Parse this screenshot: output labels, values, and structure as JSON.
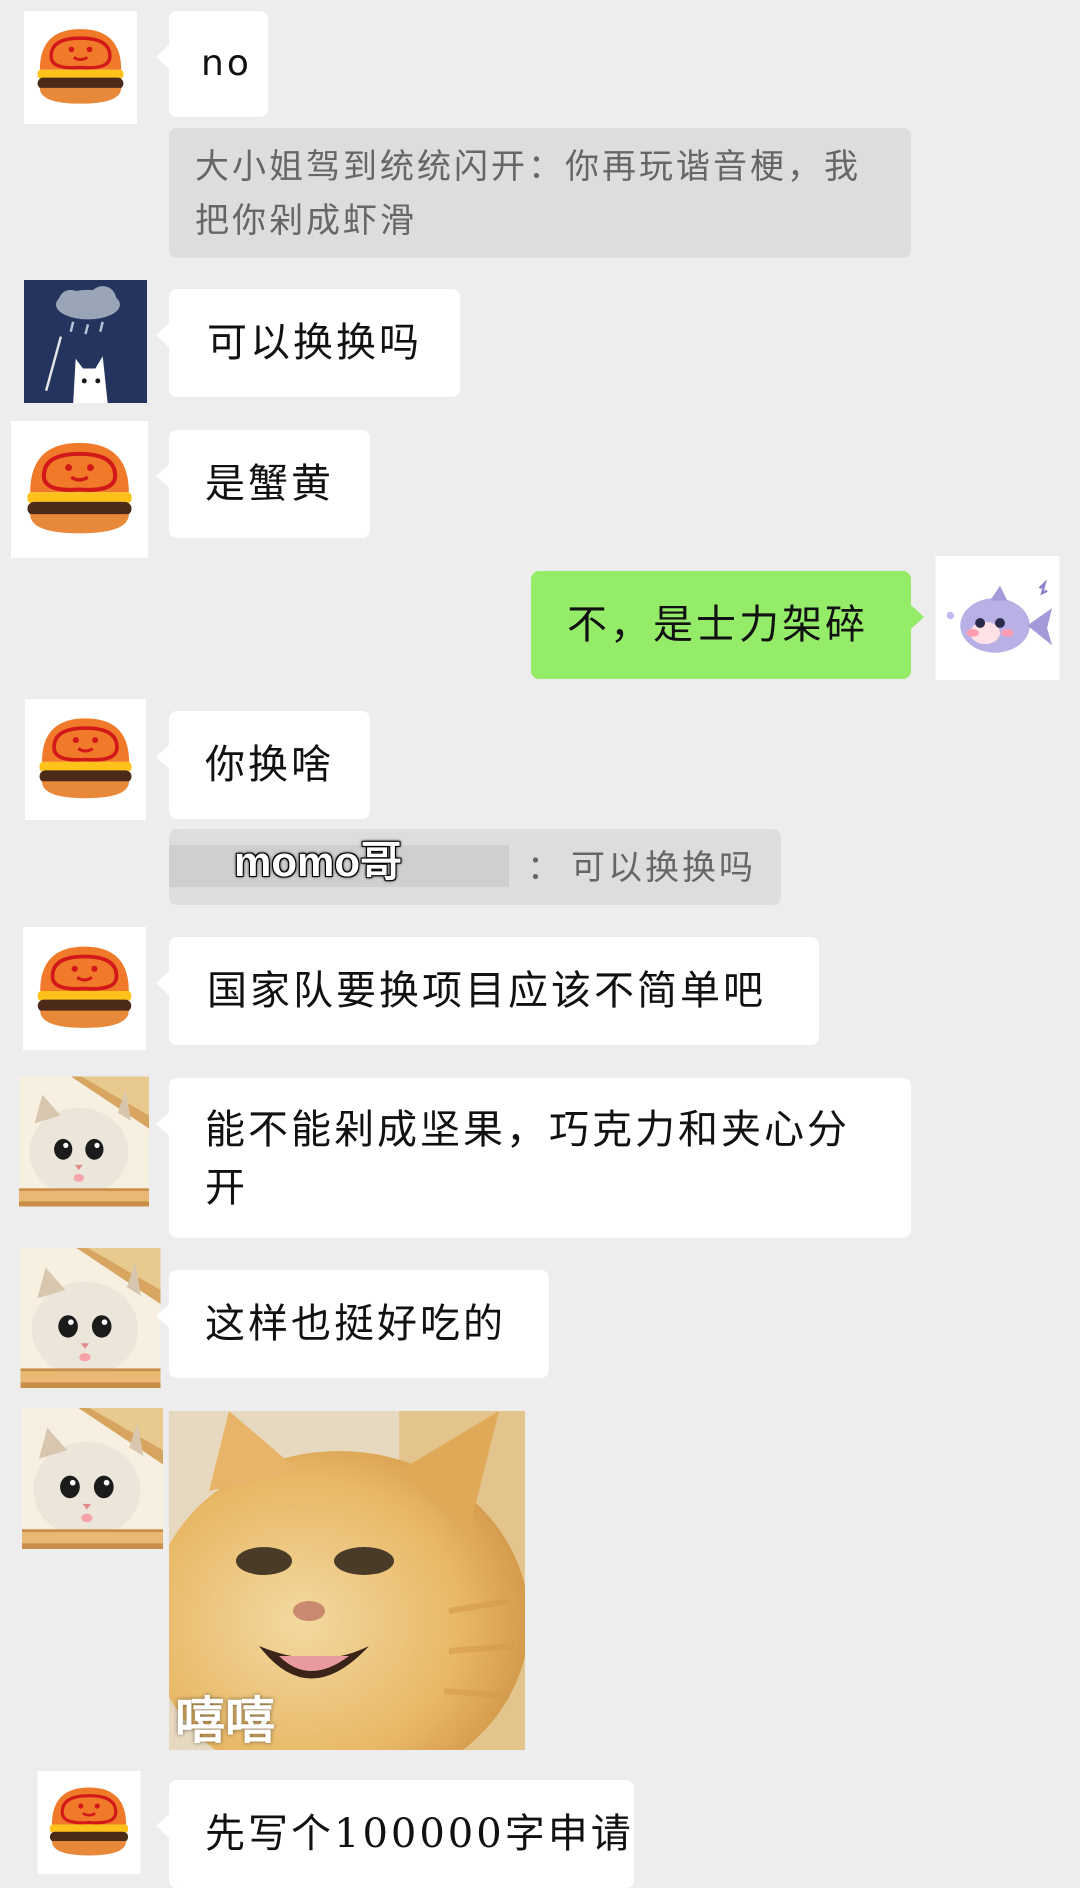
{
  "colors": {
    "background": "#ededed",
    "bubble_left": "#ffffff",
    "bubble_right": "#95ec69",
    "quote_bg": "#dddddd",
    "quote_text": "#666666"
  },
  "avatars": {
    "burger": "burger-avatar",
    "rain_cat": "rain-cloud-cat-avatar",
    "fish": "purple-fish-avatar",
    "bread_cat": "bread-cat-avatar"
  },
  "messages": [
    {
      "sender": "burger",
      "side": "left",
      "text": "no"
    },
    {
      "type": "quote",
      "text": "大小姐驾到统统闪开：你再玩谐音梗，我把你剁成虾滑"
    },
    {
      "sender": "rain_cat",
      "side": "left",
      "text": "可以换换吗"
    },
    {
      "sender": "burger",
      "side": "left",
      "text": "是蟹黄"
    },
    {
      "sender": "fish",
      "side": "right",
      "text": "不，是士力架碎"
    },
    {
      "sender": "burger",
      "side": "left",
      "text": "你换啥"
    },
    {
      "type": "quote",
      "name": "momo哥",
      "separator": "：",
      "text": "可以换换吗"
    },
    {
      "sender": "burger",
      "side": "left",
      "text": "国家队要换项目应该不简单吧"
    },
    {
      "sender": "bread_cat",
      "side": "left",
      "text": "能不能剁成坚果，巧克力和夹心分开"
    },
    {
      "sender": "bread_cat",
      "side": "left",
      "text": "这样也挺好吃的"
    },
    {
      "sender": "bread_cat",
      "side": "left",
      "type": "sticker",
      "sticker_name": "laughing-cat-sticker",
      "caption": "嘻嘻"
    },
    {
      "sender": "burger",
      "side": "left",
      "text": "先写个100000字申请"
    }
  ]
}
